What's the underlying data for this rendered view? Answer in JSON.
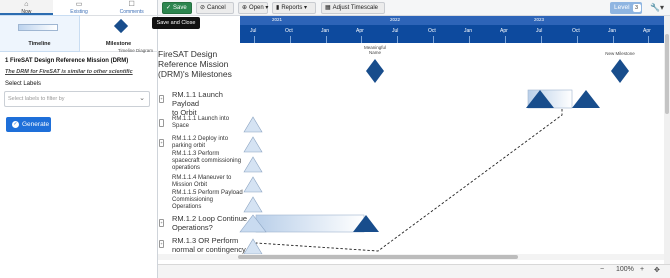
{
  "nav": {
    "tabs": [
      {
        "label": "Now",
        "icon": "home-icon"
      },
      {
        "label": "Existing",
        "icon": "folder-icon"
      },
      {
        "label": "Comments",
        "icon": "comment-icon"
      }
    ]
  },
  "templates": {
    "timeline_label": "Timeline",
    "milestone_label": "Milestone",
    "hint": "Timeline Diagram"
  },
  "project": {
    "title": "1 FireSAT Design Reference Mission (DRM)",
    "description": "The DRM for FireSAT is similar to other scientific"
  },
  "labels": {
    "title": "Select Labels",
    "placeholder": "Select labels to filter by"
  },
  "generate_label": "Generate",
  "toolbar": {
    "save": "Save",
    "cancel": "Cancel",
    "open": "Open",
    "reports": "Reports",
    "adjust": "Adjust Timescale",
    "level_label": "Level",
    "level_value": "3",
    "tooltip": "Save and Close"
  },
  "timeline": {
    "years": [
      "2021",
      "2022",
      "2023"
    ],
    "months": [
      "Jul",
      "Oct",
      "Jan",
      "Apr",
      "Jul",
      "Oct",
      "Jan",
      "Apr",
      "Jul",
      "Oct",
      "Jan",
      "Apr"
    ]
  },
  "chart": {
    "title": "FireSAT Design\nReference Mission\n(DRM)'s Milestones",
    "milestone_1": "Meaningful\nName",
    "milestone_2": "New Milestone",
    "tasks": [
      {
        "label": "RM.1.1 Launch Payload\nto Orbit",
        "expand": "+"
      },
      {
        "label": "RM.1.1.1 Launch into\nSpace",
        "expand": ""
      },
      {
        "label": "RM.1.1.2 Deploy into\nparking orbit",
        "expand": "+"
      },
      {
        "label": "RM.1.1.3 Perform\nspacecraft commissioning\noperations",
        "expand": ""
      },
      {
        "label": "RM.1.1.4 Maneuver to\nMission Orbit",
        "expand": ""
      },
      {
        "label": "RM.1.1.5 Perform Payload\nCommissioning\nOperations",
        "expand": ""
      },
      {
        "label": "RM.1.2 Loop Continue\nOperations?",
        "expand": "+"
      },
      {
        "label": "RM.1.3 OR Perform\nnormal or contingency",
        "expand": "+"
      }
    ]
  },
  "status": {
    "zoom": "100%",
    "minus": "−",
    "plus": "+"
  },
  "colors": {
    "accent": "#0d4a9e",
    "save_green": "#2d8650",
    "diamond": "#184d8c"
  }
}
